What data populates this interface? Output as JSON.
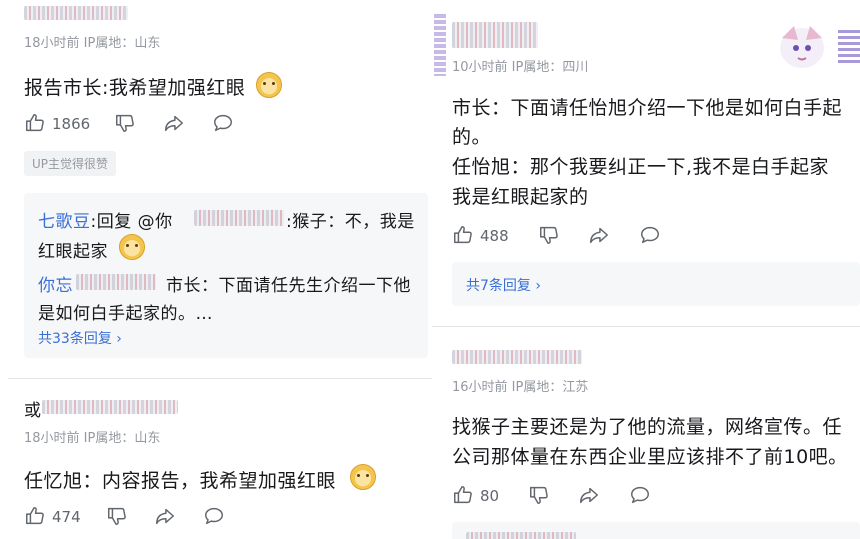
{
  "left": {
    "c1": {
      "meta": "18小时前  IP属地：山东",
      "text": "报告市长:我希望加强红眼",
      "likes": "1866",
      "badge": "UP主觉得很赞",
      "reply1_user": "七歌豆",
      "reply1_mid": ":回复 @你",
      "reply1_text_a": ":猴子：不，我是",
      "reply1_text_b": "红眼起家",
      "reply2_user": "你忘",
      "reply2_text_a": "市长：下面请任先生介绍一下他",
      "reply2_text_b": "是如何白手起家的。…",
      "reply_total": "共33条回复 ›"
    },
    "c2": {
      "user": "或",
      "meta": "18小时前  IP属地：山东",
      "text": "任忆旭：内容报告，我希望加强红眼",
      "likes": "474"
    }
  },
  "right": {
    "c1": {
      "meta": "10小时前  IP属地：四川",
      "text_a": "市长：下面请任怡旭介绍一下他是如何白手起",
      "text_b": "的。",
      "text_c": "任怡旭：那个我要纠正一下,我不是白手起家",
      "text_d": "我是红眼起家的",
      "likes": "488",
      "reply_total": "共7条回复 ›"
    },
    "c2": {
      "meta": "16小时前  IP属地：江苏",
      "text_a": "找猴子主要还是为了他的流量，网络宣传。任",
      "text_b": "公司那体量在东西企业里应该排不了前10吧。",
      "likes": "80"
    }
  },
  "icons": {
    "like": "thumbs-up-icon",
    "dislike": "thumbs-down-icon",
    "share": "share-icon",
    "comment": "comment-icon",
    "emoji": "dog-emoji-icon",
    "sticker": "anime-sticker-icon"
  }
}
